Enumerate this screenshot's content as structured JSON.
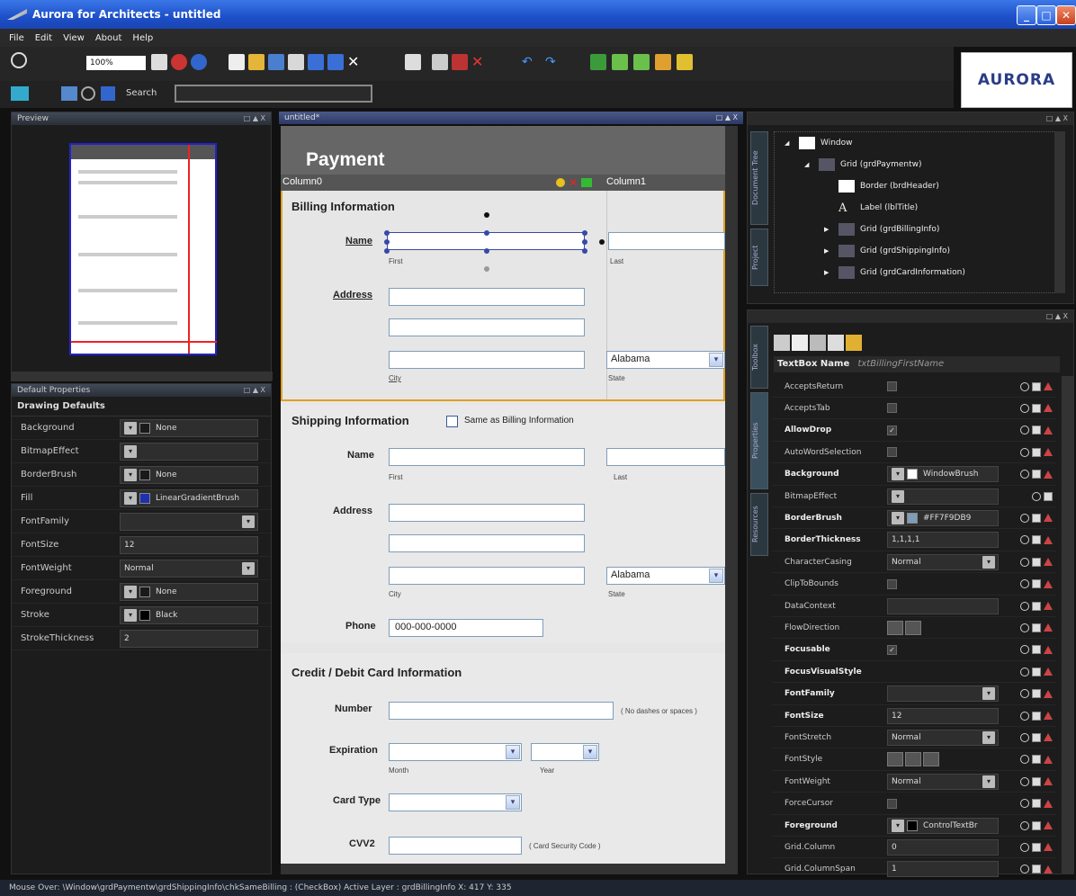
{
  "app": {
    "title": "Aurora for Architects - untitled",
    "logo_text": "AURORA"
  },
  "menu": [
    "File",
    "Edit",
    "View",
    "About",
    "Help"
  ],
  "toolbar": {
    "zoom": "100%",
    "search_label": "Search",
    "search_value": ""
  },
  "preview": {
    "title": "Preview",
    "ctl": "□ ▲ X"
  },
  "defaults": {
    "title": "Default Properties",
    "ctl": "□ ▲ X",
    "heading": "Drawing Defaults",
    "rows": [
      {
        "label": "Background",
        "value": "None",
        "kind": "brush",
        "color": "#1a1a1a"
      },
      {
        "label": "BitmapEffect",
        "value": "",
        "kind": "drop"
      },
      {
        "label": "BorderBrush",
        "value": "None",
        "kind": "brush",
        "color": "#1a1a1a"
      },
      {
        "label": "Fill",
        "value": "LinearGradientBrush",
        "kind": "brush",
        "color": "#1e2fb0"
      },
      {
        "label": "FontFamily",
        "value": "",
        "kind": "combo"
      },
      {
        "label": "FontSize",
        "value": "12",
        "kind": "text"
      },
      {
        "label": "FontWeight",
        "value": "Normal",
        "kind": "combo"
      },
      {
        "label": "Foreground",
        "value": "None",
        "kind": "brush",
        "color": "#1a1a1a"
      },
      {
        "label": "Stroke",
        "value": "Black",
        "kind": "brush",
        "color": "#000000"
      },
      {
        "label": "StrokeThickness",
        "value": "2",
        "kind": "text"
      }
    ]
  },
  "doc": {
    "tab": "untitled*",
    "ctl": "□ ▲ X",
    "header": "Payment",
    "col0": "Column0",
    "col1": "Column1"
  },
  "billing": {
    "title": "Billing Information",
    "name": "Name",
    "first": "First",
    "last": "Last",
    "address": "Address",
    "city": "City",
    "state": "State",
    "state_value": "Alabama"
  },
  "shipping": {
    "title": "Shipping Information",
    "same": "Same as Billing Information",
    "name": "Name",
    "first": "First",
    "last": "Last",
    "address": "Address",
    "city": "City",
    "state": "State",
    "state_value": "Alabama",
    "phone": "Phone",
    "phone_value": "000-000-0000"
  },
  "card": {
    "title": "Credit / Debit Card Information",
    "number": "Number",
    "number_hint": "( No dashes or spaces )",
    "expiration": "Expiration",
    "month": "Month",
    "year": "Year",
    "card_type": "Card Type",
    "cvv": "CVV2",
    "cvv_hint": "( Card Security Code )"
  },
  "tree": {
    "ctl": "□ ▲ X",
    "tabs": [
      "Document Tree",
      "Project"
    ],
    "items": [
      {
        "label": "Window",
        "indent": 0,
        "expander": "◢"
      },
      {
        "label": "Grid (grdPaymentw)",
        "indent": 1,
        "expander": "◢"
      },
      {
        "label": "Border (brdHeader)",
        "indent": 2,
        "expander": ""
      },
      {
        "label": "Label (lblTitle)",
        "indent": 2,
        "expander": ""
      },
      {
        "label": "Grid (grdBillingInfo)",
        "indent": 2,
        "expander": "▶"
      },
      {
        "label": "Grid (grdShippingInfo)",
        "indent": 2,
        "expander": "▶"
      },
      {
        "label": "Grid (grdCardInformation)",
        "indent": 2,
        "expander": "▶"
      }
    ]
  },
  "props": {
    "ctl": "□ ▲ X",
    "tabs": [
      "Toolbox",
      "Properties",
      "Resources"
    ],
    "name_label": "TextBox Name",
    "name_value": "txtBillingFirstName",
    "rows": [
      {
        "label": "AcceptsReturn",
        "value": "",
        "kind": "check",
        "bold": false
      },
      {
        "label": "AcceptsTab",
        "value": "",
        "kind": "check",
        "bold": false
      },
      {
        "label": "AllowDrop",
        "value": "✓",
        "kind": "check",
        "bold": true
      },
      {
        "label": "AutoWordSelection",
        "value": "",
        "kind": "check",
        "bold": false
      },
      {
        "label": "Background",
        "value": "WindowBrush",
        "kind": "brush",
        "color": "#ffffff",
        "bold": true
      },
      {
        "label": "BitmapEffect",
        "value": "",
        "kind": "drop",
        "bold": false
      },
      {
        "label": "BorderBrush",
        "value": "#FF7F9DB9",
        "kind": "brush",
        "color": "#7f9db9",
        "bold": true
      },
      {
        "label": "BorderThickness",
        "value": "1,1,1,1",
        "kind": "text",
        "bold": true
      },
      {
        "label": "CharacterCasing",
        "value": "Normal",
        "kind": "combo",
        "bold": false
      },
      {
        "label": "ClipToBounds",
        "value": "",
        "kind": "check",
        "bold": false
      },
      {
        "label": "DataContext",
        "value": "",
        "kind": "text",
        "bold": false
      },
      {
        "label": "FlowDirection",
        "value": "",
        "kind": "buttons",
        "bold": false
      },
      {
        "label": "Focusable",
        "value": "✓",
        "kind": "check",
        "bold": true
      },
      {
        "label": "FocusVisualStyle",
        "value": "",
        "kind": "none",
        "bold": true
      },
      {
        "label": "FontFamily",
        "value": "",
        "kind": "combo",
        "bold": true
      },
      {
        "label": "FontSize",
        "value": "12",
        "kind": "text",
        "bold": true
      },
      {
        "label": "FontStretch",
        "value": "Normal",
        "kind": "combo",
        "bold": false
      },
      {
        "label": "FontStyle",
        "value": "",
        "kind": "buttons",
        "bold": false
      },
      {
        "label": "FontWeight",
        "value": "Normal",
        "kind": "combo",
        "bold": false
      },
      {
        "label": "ForceCursor",
        "value": "",
        "kind": "check",
        "bold": false
      },
      {
        "label": "Foreground",
        "value": "ControlTextBr",
        "kind": "brush",
        "color": "#000000",
        "bold": true
      },
      {
        "label": "Grid.Column",
        "value": "0",
        "kind": "text",
        "bold": false
      },
      {
        "label": "Grid.ColumnSpan",
        "value": "1",
        "kind": "text",
        "bold": false
      }
    ]
  },
  "status": "Mouse Over: \\Window\\grdPaymentw\\grdShippingInfo\\chkSameBilling : (CheckBox)  Active Layer : grdBillingInfo   X: 417  Y: 335"
}
